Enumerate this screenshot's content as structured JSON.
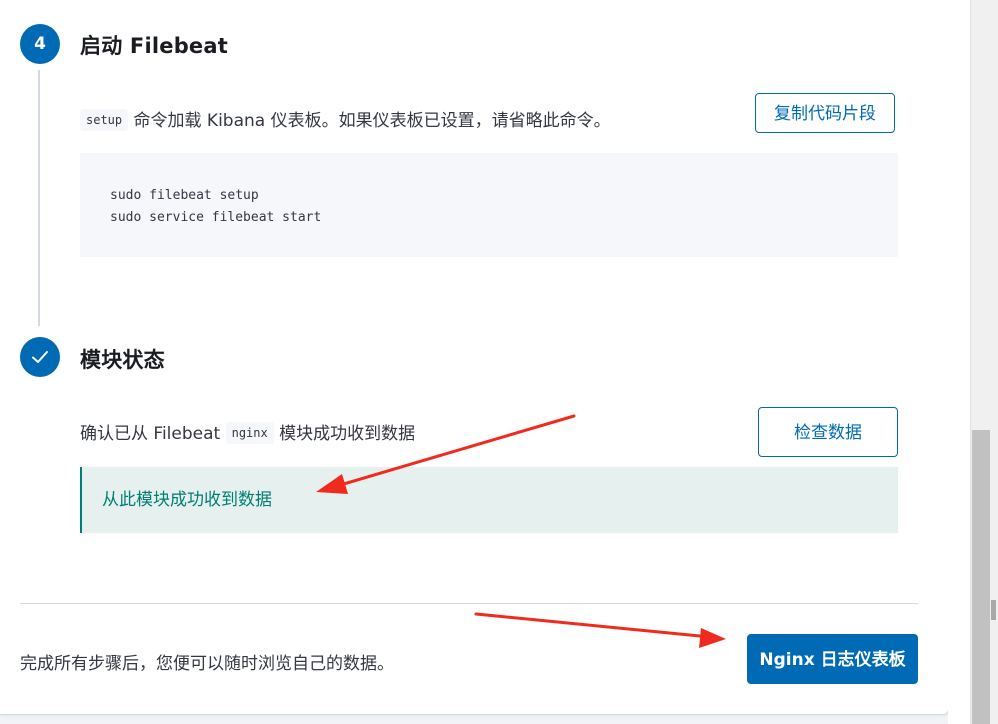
{
  "steps": {
    "start": {
      "number": "4",
      "title": "启动 Filebeat",
      "description": {
        "code": "setup",
        "text": "命令加载 Kibana 仪表板。如果仪表板已设置，请省略此命令。"
      },
      "copy_button": "复制代码片段",
      "code_lines": [
        "sudo filebeat setup",
        "sudo service filebeat start"
      ]
    },
    "module_status": {
      "title": "模块状态",
      "description": {
        "prefix": "确认已从 Filebeat",
        "code": "nginx",
        "suffix": "模块成功收到数据"
      },
      "check_button": "检查数据",
      "success_message": "从此模块成功收到数据"
    }
  },
  "footer": {
    "text": "完成所有步骤后，您便可以随时浏览自己的数据。",
    "dashboard_button": "Nginx 日志仪表板"
  },
  "colors": {
    "primary": "#006bb4",
    "success": "#017d73",
    "success_bg": "#e6f1ef",
    "annotation_arrow": "#f02a1d"
  },
  "icons": {
    "step_complete": "check-icon"
  }
}
